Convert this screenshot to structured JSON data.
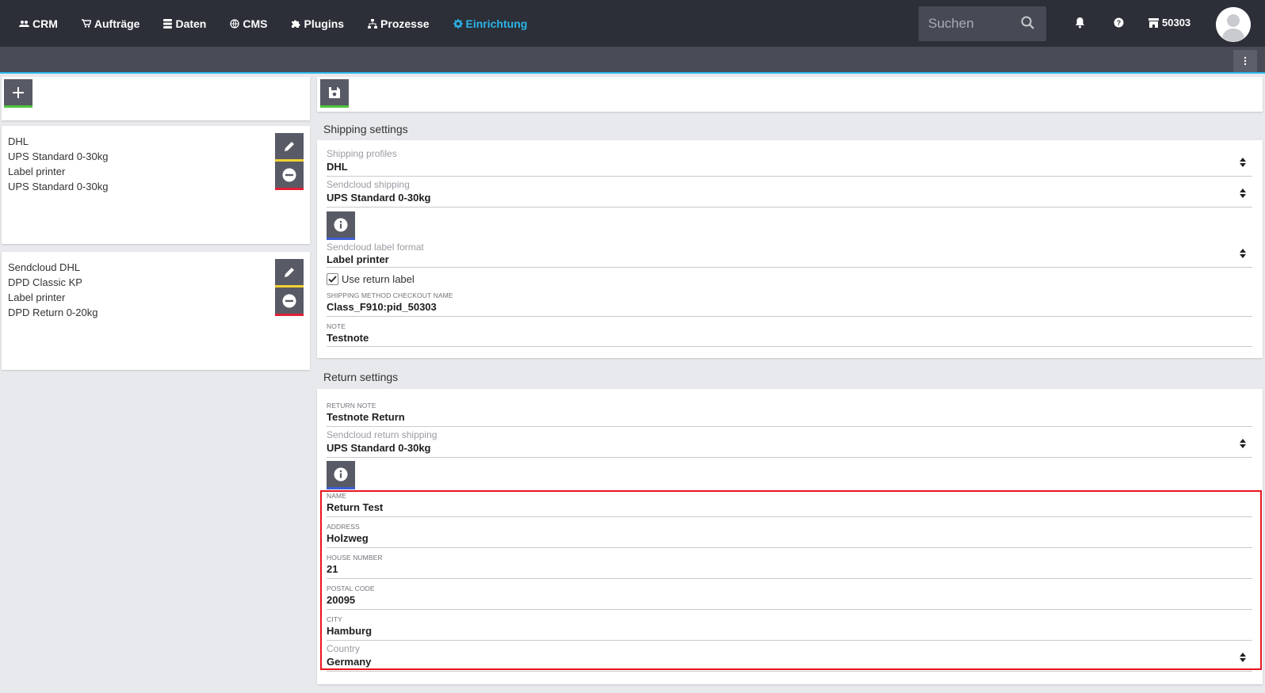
{
  "nav": {
    "items": [
      {
        "label": "CRM",
        "icon": "users-icon"
      },
      {
        "label": "Aufträge",
        "icon": "cart-icon"
      },
      {
        "label": "Daten",
        "icon": "database-icon"
      },
      {
        "label": "CMS",
        "icon": "globe-icon"
      },
      {
        "label": "Plugins",
        "icon": "puzzle-icon"
      },
      {
        "label": "Prozesse",
        "icon": "process-icon"
      },
      {
        "label": "Einrichtung",
        "icon": "gear-icon",
        "active": true
      }
    ],
    "search_placeholder": "Suchen",
    "store_id": "50303"
  },
  "left": {
    "cards": [
      {
        "lines": [
          "DHL",
          "UPS Standard 0-30kg",
          "Label printer",
          "UPS Standard 0-30kg"
        ]
      },
      {
        "lines": [
          "Sendcloud DHL",
          "DPD Classic KP",
          "Label printer",
          "DPD Return 0-20kg"
        ]
      }
    ]
  },
  "shipping": {
    "title": "Shipping settings",
    "profiles_label": "Shipping profiles",
    "profiles_value": "DHL",
    "sendcloud_label": "Sendcloud shipping",
    "sendcloud_value": "UPS Standard 0-30kg",
    "label_format_label": "Sendcloud label format",
    "label_format_value": "Label printer",
    "use_return_label": "Use return label",
    "use_return_checked": true,
    "checkout_name_label": "SHIPPING METHOD CHECKOUT NAME",
    "checkout_name_value": "Class_F910:pid_50303",
    "note_label": "NOTE",
    "note_value": "Testnote"
  },
  "return": {
    "title": "Return settings",
    "note_label": "RETURN NOTE",
    "note_value": "Testnote Return",
    "shipping_label": "Sendcloud return shipping",
    "shipping_value": "UPS Standard 0-30kg",
    "name_label": "NAME",
    "name_value": "Return Test",
    "address_label": "ADDRESS",
    "address_value": "Holzweg",
    "house_label": "HOUSE NUMBER",
    "house_value": "21",
    "postal_label": "POSTAL CODE",
    "postal_value": "20095",
    "city_label": "CITY",
    "city_value": "Hamburg",
    "country_label": "Country",
    "country_value": "Germany"
  },
  "colors": {
    "accent": "#2bb5e8",
    "topbar": "#2c2f38",
    "highlight": "#e8141f"
  }
}
